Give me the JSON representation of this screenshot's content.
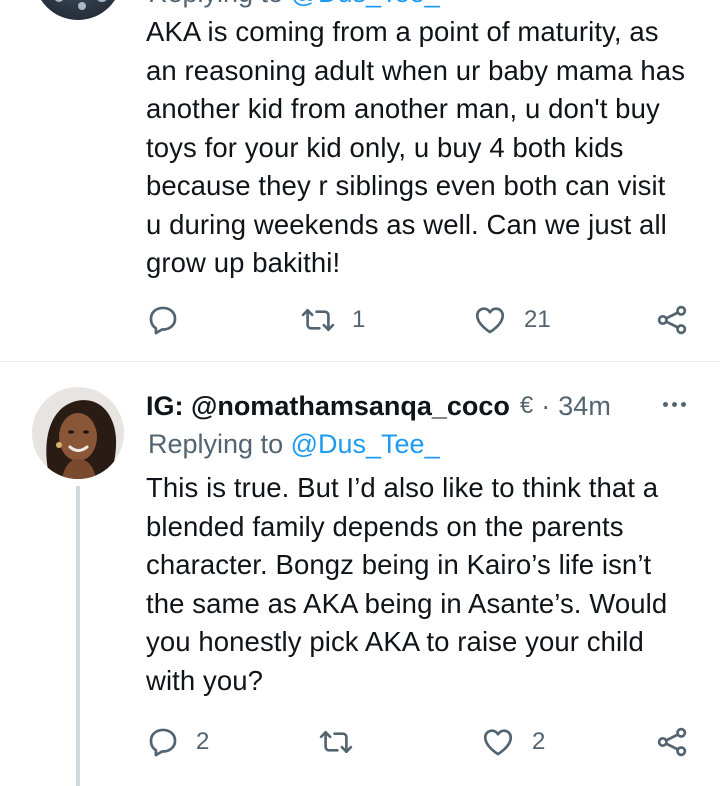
{
  "first_tweet": {
    "header_fragment_prefix": "Replying to ",
    "header_fragment_mention": "@Dus_Tee_",
    "text": "AKA is coming from a point of maturity, as\nan reasoning adult when ur baby mama has\nanother kid from another man, u don't buy\ntoys for your kid only, u buy 4 both kids\nbecause they r siblings even both can visit\nu during weekends as well. Can we just all\ngrow up bakithi!",
    "actions": {
      "reply_count": "",
      "retweet_count": "1",
      "like_count": "21"
    }
  },
  "second_tweet": {
    "display_name": "IG: @nomathamsanqa_coco",
    "verified_glyph": "€",
    "separator": "·",
    "time": "34m",
    "replying_prefix": "Replying to ",
    "replying_mention": "@Dus_Tee_",
    "text": "This is true. But I’d also like to think that a\nblended family depends on the parents\ncharacter. Bongz being in Kairo’s life isn’t\nthe same as AKA being in Asante’s. Would\nyou honestly pick AKA to raise your child\nwith you?",
    "actions": {
      "reply_count": "2",
      "retweet_count": "",
      "like_count": "2"
    }
  },
  "icons": {
    "reply": "speech-bubble-icon",
    "retweet": "retweet-arrows-icon",
    "like": "heart-icon",
    "share": "share-nodes-icon",
    "more": "more-dots-icon"
  },
  "colors": {
    "text": "#0f1419",
    "secondary": "#536471",
    "link": "#1d9bf0",
    "divider": "#e6eaed",
    "thread_line": "#cfd9de"
  }
}
